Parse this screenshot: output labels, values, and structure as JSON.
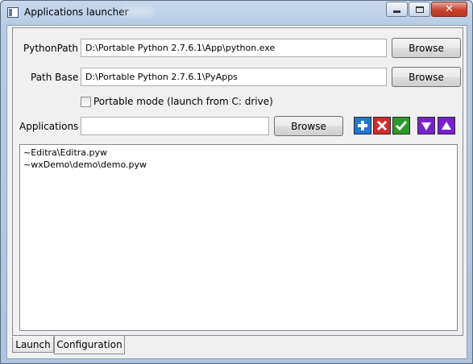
{
  "window": {
    "title": "Applications launcher",
    "controls": {
      "minimize": "minimize",
      "maximize": "maximize",
      "close": "✕"
    }
  },
  "python_path": {
    "label": "PythonPath",
    "value": "D:\\Portable Python 2.7.6.1\\App\\python.exe",
    "browse_label": "Browse"
  },
  "path_base": {
    "label": "Path Base",
    "value": "D:\\Portable Python 2.7.6.1\\PyApps",
    "browse_label": "Browse"
  },
  "portable_mode": {
    "label": "Portable mode (launch from C: drive)",
    "checked": false
  },
  "applications": {
    "label": "Applications",
    "value": "",
    "browse_label": "Browse",
    "actions": [
      {
        "icon": "add-icon",
        "color": "#1f78d1"
      },
      {
        "icon": "remove-icon",
        "color": "#d42a2a"
      },
      {
        "icon": "confirm-icon",
        "color": "#2a9a2a"
      },
      {
        "icon": "move-down-icon",
        "color": "#7a1fd0"
      },
      {
        "icon": "move-up-icon",
        "color": "#7a1fd0"
      }
    ],
    "items": [
      "~Editra\\Editra.pyw",
      "~wxDemo\\demo\\demo.pyw"
    ]
  },
  "tabs": [
    {
      "label": "Launch",
      "active": false
    },
    {
      "label": "Configuration",
      "active": true
    }
  ]
}
